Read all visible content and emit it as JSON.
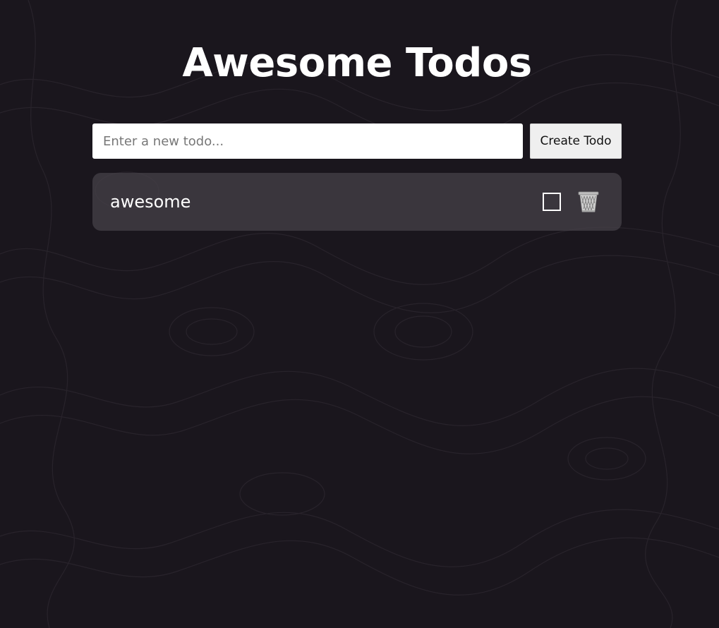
{
  "app": {
    "title": "Awesome Todos"
  },
  "form": {
    "input_placeholder": "Enter a new todo...",
    "input_value": "",
    "create_label": "Create Todo"
  },
  "todos": [
    {
      "text": "awesome",
      "completed": false,
      "checkbox_icon": "checkbox-unchecked-icon",
      "delete_icon": "trash-basket-icon"
    }
  ],
  "colors": {
    "background": "#1a161d",
    "todo_card": "#46424a",
    "title_text": "#ffffff"
  }
}
